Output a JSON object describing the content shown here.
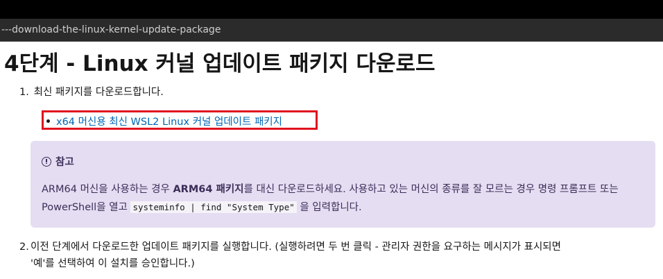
{
  "browser": {
    "url_fragment": "---download-the-linux-kernel-update-package"
  },
  "page": {
    "heading": "4단계 - Linux 커널 업데이트 패키지 다운로드",
    "step1": {
      "number": "1.",
      "text": "최신 패키지를 다운로드합니다."
    },
    "bullet_link": "x64 머신용 최신 WSL2 Linux 커널 업데이트 패키지",
    "note": {
      "title": "참고",
      "icon": "info-circle-icon",
      "body_part1": "ARM64 머신을 사용하는 경우 ",
      "body_bold": "ARM64 패키지",
      "body_part2": "를 대신 다운로드하세요. 사용하고 있는 머신의 종류를 잘 모르는 경우 명령 프롬프트 또는 PowerShell을 열고 ",
      "body_code": "systeminfo | find \"System Type\"",
      "body_part3": " 을 입력합니다."
    },
    "step2": {
      "number": "2.",
      "line1": "이전 단계에서 다운로드한 업데이트 패키지를 실행합니다. (실행하려면 두 번 클릭 - 관리자 권한을 요구하는 메시지가 표시되면",
      "line2": "'예'를 선택하여 이 설치를 승인합니다.)"
    },
    "colors": {
      "link": "#0065b3",
      "highlight_box": "#e0101e",
      "note_bg": "#e5ddf2"
    }
  }
}
